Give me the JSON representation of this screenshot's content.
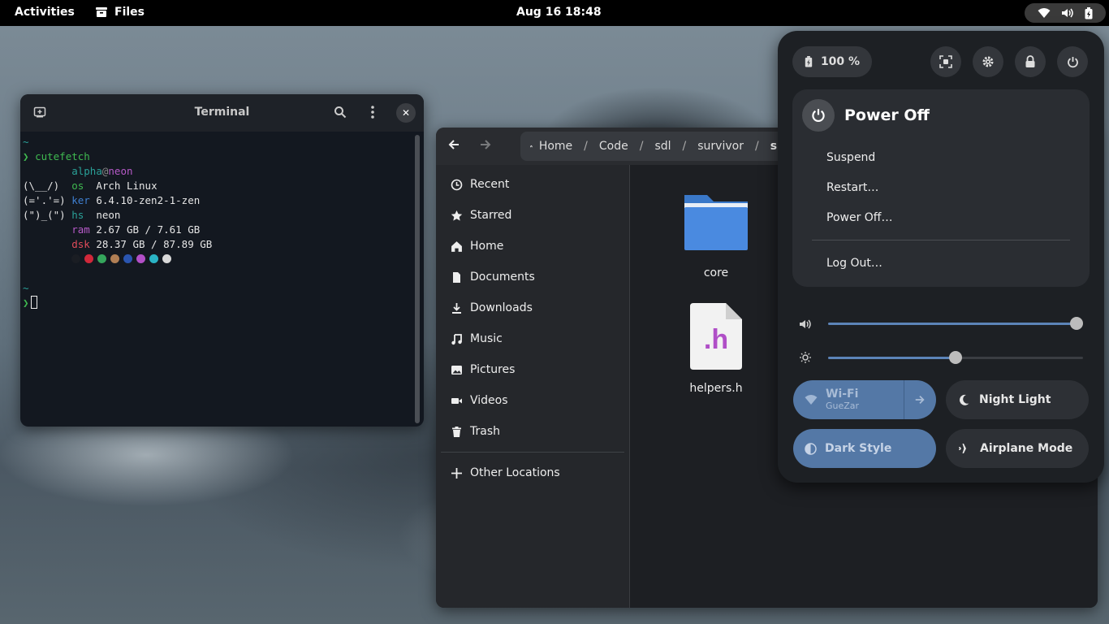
{
  "topbar": {
    "activities": "Activities",
    "app_name": "Files",
    "clock": "Aug 16  18:48"
  },
  "terminal": {
    "title": "Terminal",
    "lines": {
      "prompt_tilde1": "~",
      "cmd": "cutefetch",
      "user": "alpha",
      "at": "@",
      "host": "neon",
      "art1": "(\\__/)",
      "art2": "(='.'=)",
      "art3": "(\")_(\")",
      "os_key": "os",
      "os_val": "Arch Linux",
      "ker_key": "ker",
      "ker_val": "6.4.10-zen2-1-zen",
      "hs_key": "hs",
      "hs_val": "neon",
      "ram_key": "ram",
      "ram_val": "2.67 GB / 7.61 GB",
      "dsk_key": "dsk",
      "dsk_val": "28.37 GB / 87.89 GB",
      "prompt_tilde2": "~",
      "prompt_arrow": "❯"
    },
    "palette": [
      "#1a1d23",
      "#d0283a",
      "#35a65c",
      "#b07e54",
      "#2a55b0",
      "#b24fc7",
      "#2ab3c4",
      "#d8d8d8"
    ]
  },
  "files": {
    "breadcrumbs": [
      "Home",
      "Code",
      "sdl",
      "survivor",
      "su"
    ],
    "sidebar": {
      "recent": "Recent",
      "starred": "Starred",
      "home": "Home",
      "documents": "Documents",
      "downloads": "Downloads",
      "music": "Music",
      "pictures": "Pictures",
      "videos": "Videos",
      "trash": "Trash",
      "other": "Other Locations"
    },
    "items": {
      "folder_name": "core",
      "file_name": "helpers.h",
      "file_glyph": ".h"
    }
  },
  "quick_settings": {
    "battery": "100 %",
    "power_menu": {
      "title": "Power Off",
      "suspend": "Suspend",
      "restart": "Restart…",
      "power_off": "Power Off…",
      "log_out": "Log Out…"
    },
    "volume_level": 1.0,
    "brightness_level": 0.5,
    "tiles": {
      "wifi_title": "Wi-Fi",
      "wifi_sub": "GueZar",
      "night_light": "Night Light",
      "dark_style": "Dark Style",
      "airplane": "Airplane Mode"
    },
    "accent": "#5478a6"
  }
}
